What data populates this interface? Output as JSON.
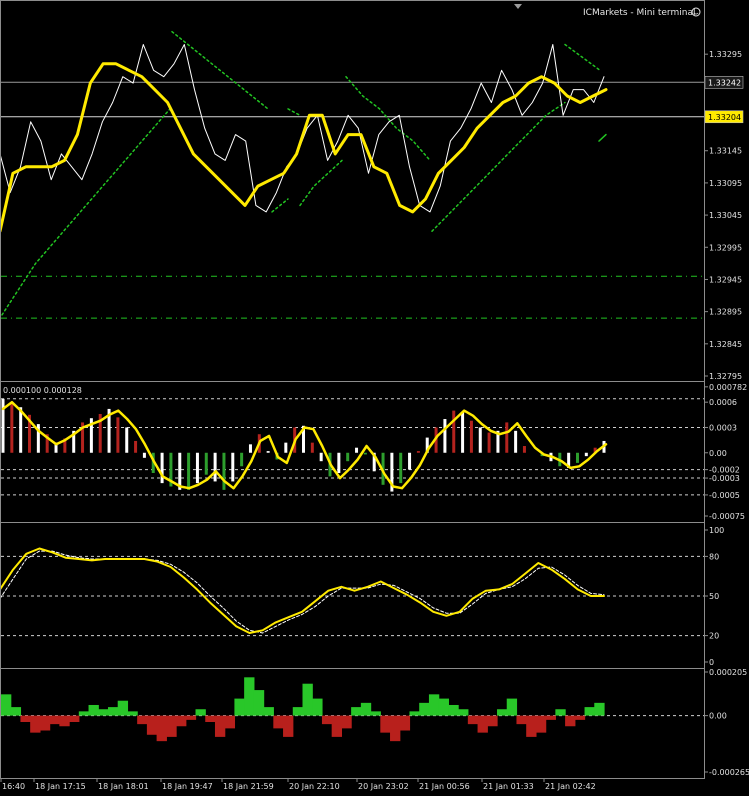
{
  "window": {
    "title": "ICMarkets - Mini terminal",
    "icon": "smiley-icon"
  },
  "colors": {
    "background": "#000000",
    "axis": "#8c8c8c",
    "text": "#e0e0e0",
    "price": "#ffffff",
    "ma": "#ffea00",
    "envelope": "#22c322",
    "osc_hist": "#ffffff",
    "osc_hist_up": "#b4231e",
    "hist_down": "#2d9e2d",
    "stoch": "#ffea00",
    "bars_up": "#29c729",
    "bars_down": "#b8201c",
    "price_tag_bg": "#ffea00",
    "price_tag_fg": "#000000"
  },
  "chart_data": [
    {
      "type": "line",
      "panel": "main",
      "ylim": [
        1.32795,
        1.33345
      ],
      "y_ticks": [
        "1.33295",
        "1.33145",
        "1.33095",
        "1.33045",
        "1.32995",
        "1.32945",
        "1.32895",
        "1.32845",
        "1.32795"
      ],
      "price_tags": [
        "1.33242",
        "1.33204"
      ],
      "dashed_levels": [
        1.3295,
        1.32885
      ],
      "series": [
        {
          "role": "price",
          "values": [
            1.3314,
            1.3308,
            1.3312,
            1.3319,
            1.3316,
            1.331,
            1.3314,
            1.3312,
            1.331,
            1.3314,
            1.3319,
            1.3322,
            1.3326,
            1.3325,
            1.3331,
            1.3327,
            1.3326,
            1.3328,
            1.3331,
            1.3324,
            1.3318,
            1.3314,
            1.3313,
            1.3317,
            1.3316,
            1.3306,
            1.3305,
            1.3308,
            1.3312,
            1.3314,
            1.3318,
            1.332,
            1.3313,
            1.3316,
            1.332,
            1.3318,
            1.3311,
            1.3317,
            1.3319,
            1.332,
            1.3312,
            1.3306,
            1.3305,
            1.3309,
            1.3316,
            1.3318,
            1.3321,
            1.3325,
            1.3322,
            1.3327,
            1.3324,
            1.332,
            1.3322,
            1.3325,
            1.3331,
            1.332,
            1.3324,
            1.3324,
            1.3322,
            1.3326
          ]
        },
        {
          "role": "moving-average",
          "values": [
            1.3302,
            1.3311,
            1.3312,
            1.3312,
            1.3312,
            1.3313,
            1.3317,
            1.3325,
            1.3328,
            1.3328,
            1.3327,
            1.3326,
            1.3324,
            1.3322,
            1.3318,
            1.3314,
            1.3312,
            1.331,
            1.3308,
            1.3306,
            1.3309,
            1.331,
            1.3311,
            1.3314,
            1.332,
            1.332,
            1.3314,
            1.3317,
            1.3317,
            1.3312,
            1.3311,
            1.3306,
            1.3305,
            1.3307,
            1.3311,
            1.3313,
            1.3315,
            1.3318,
            1.332,
            1.3322,
            1.3323,
            1.3325,
            1.3326,
            1.3325,
            1.3323,
            1.3322,
            1.3323,
            1.3324
          ]
        },
        {
          "role": "envelope-lower-left",
          "values": [
            1.3289,
            1.3293,
            1.3297,
            1.33,
            1.3303,
            1.3306,
            1.3309,
            1.3312,
            1.3315,
            1.3318,
            1.3321
          ]
        },
        {
          "role": "envelope-upper",
          "values": [
            1.3333,
            1.333,
            1.3327,
            1.3324,
            1.3321
          ]
        },
        {
          "role": "envelope-segment-a",
          "values": [
            1.3305,
            1.3307
          ]
        },
        {
          "role": "envelope-segment-b",
          "values": [
            1.3321,
            1.332
          ]
        },
        {
          "role": "envelope-segment-c",
          "values": [
            1.3306,
            1.3309,
            1.3311,
            1.3313
          ]
        },
        {
          "role": "envelope-segment-d",
          "values": [
            1.3326,
            1.3323,
            1.3321,
            1.3318,
            1.3316,
            1.3313
          ]
        },
        {
          "role": "envelope-lower-right",
          "values": [
            1.3302,
            1.3305,
            1.3308,
            1.3311,
            1.3314,
            1.3317,
            1.332,
            1.3322
          ]
        },
        {
          "role": "envelope-upper-right",
          "values": [
            1.3331,
            1.3329,
            1.3327
          ]
        },
        {
          "role": "envelope-tail",
          "values": [
            1.3316,
            1.3317
          ]
        }
      ]
    },
    {
      "type": "bar",
      "panel": "oscillator",
      "header": "0.000100 0.000128",
      "ylim": [
        -0.00075,
        0.00078
      ],
      "y_ticks": [
        "0.000782",
        "0.0006",
        "0.0003",
        "0.00",
        "-0.0002",
        "-0.0003",
        "-0.0005",
        "-0.00075"
      ],
      "dashed_levels": [
        0.00064,
        0.0003,
        -0.0002,
        -0.0003,
        -0.0005
      ],
      "signal": [
        0.00052,
        0.0006,
        0.0005,
        0.00038,
        0.00026,
        0.00018,
        0.0001,
        0.00015,
        0.00022,
        0.0003,
        0.00034,
        0.00038,
        0.00045,
        0.0005,
        0.0004,
        0.00028,
        0.0001,
        -0.0001,
        -0.00028,
        -0.00034,
        -0.0004,
        -0.00042,
        -0.00038,
        -0.00032,
        -0.00022,
        -0.00034,
        -0.00042,
        -0.00028,
        -0.0001,
        0.00014,
        0.0002,
        -5e-05,
        -0.00012,
        0.00016,
        0.0003,
        0.00028,
        8e-05,
        -0.00015,
        -0.0003,
        -0.0002,
        -8e-05,
        8e-05,
        -5e-05,
        -0.00025,
        -0.0004,
        -0.00042,
        -0.0003,
        -0.00015,
        5e-05,
        0.0002,
        0.0003,
        0.0004,
        0.0005,
        0.00044,
        0.00034,
        0.00026,
        0.00022,
        0.00025,
        0.00035,
        0.0002,
        6e-05,
        -2e-05,
        -5e-05,
        -0.0001,
        -0.00018,
        -0.00016,
        -8e-05,
        2e-05,
        0.0001
      ],
      "values": [
        0.00064,
        0.0006,
        0.00054,
        0.00045,
        0.00034,
        0.00022,
        0.00012,
        0.00017,
        0.00026,
        0.00036,
        0.00041,
        0.00046,
        0.00052,
        0.00042,
        0.0003,
        0.00014,
        -6e-05,
        -0.00024,
        -0.00036,
        -0.0004,
        -0.00044,
        -0.00044,
        -0.00036,
        -0.00026,
        -0.00034,
        -0.00044,
        -0.00034,
        -0.00016,
        0.0001,
        0.00022,
        2e-05,
        -8e-05,
        0.00012,
        0.0003,
        0.00032,
        0.00012,
        -0.0001,
        -0.00028,
        -0.00024,
        -0.0001,
        6e-05,
        -2e-05,
        -0.00022,
        -0.00038,
        -0.00046,
        -0.00036,
        -0.0002,
        2e-05,
        0.00018,
        0.0003,
        0.0004,
        0.0005,
        0.00048,
        0.00038,
        0.0003,
        0.00024,
        0.00026,
        0.00036,
        0.00026,
        8e-05,
        0.0,
        -4e-05,
        -0.0001,
        -0.00016,
        -0.00018,
        -0.00012,
        -4e-05,
        6e-05,
        0.00014
      ]
    },
    {
      "type": "line",
      "panel": "stochastic",
      "ylim": [
        0,
        100
      ],
      "y_ticks": [
        "100",
        "80",
        "50",
        "20",
        "0"
      ],
      "dashed_levels": [
        80,
        50,
        20
      ],
      "series": [
        {
          "role": "main",
          "values": [
            55,
            70,
            82,
            86,
            83,
            79,
            78,
            77,
            78,
            78,
            78,
            78,
            76,
            72,
            64,
            55,
            45,
            36,
            27,
            22,
            24,
            30,
            34,
            38,
            46,
            54,
            57,
            54,
            57,
            61,
            56,
            51,
            45,
            38,
            35,
            38,
            48,
            54,
            55,
            59,
            67,
            75,
            70,
            63,
            55,
            50,
            50
          ]
        },
        {
          "role": "signal",
          "values": [
            48,
            63,
            78,
            84,
            84,
            81,
            79,
            78,
            78,
            78,
            78,
            78,
            77,
            74,
            68,
            60,
            50,
            41,
            31,
            24,
            22,
            27,
            32,
            36,
            42,
            50,
            56,
            56,
            56,
            59,
            58,
            53,
            48,
            41,
            37,
            37,
            44,
            52,
            55,
            57,
            63,
            71,
            72,
            66,
            58,
            52,
            51
          ]
        }
      ]
    },
    {
      "type": "bar",
      "panel": "histogram",
      "ylim": [
        -0.000265,
        0.000205
      ],
      "y_ticks": [
        "0.000205",
        "0.00",
        "-0.000265"
      ],
      "values": [
        0.0001,
        4e-05,
        -3e-05,
        -8e-05,
        -7e-05,
        -4e-05,
        -5e-05,
        -3e-05,
        2e-05,
        5e-05,
        3e-05,
        4e-05,
        7e-05,
        2e-05,
        -4e-05,
        -9e-05,
        -0.00012,
        -0.0001,
        -5e-05,
        -2e-05,
        3e-05,
        -3e-05,
        -0.0001,
        -6e-05,
        8e-05,
        0.00018,
        0.00012,
        4e-05,
        -6e-05,
        -0.0001,
        4e-05,
        0.00015,
        8e-05,
        -4e-05,
        -0.0001,
        -6e-05,
        4e-05,
        6e-05,
        2e-05,
        -8e-05,
        -0.00012,
        -7e-05,
        2e-05,
        6e-05,
        0.0001,
        8e-05,
        5e-05,
        3e-05,
        -4e-05,
        -8e-05,
        -5e-05,
        3e-05,
        8e-05,
        -4e-05,
        -0.0001,
        -8e-05,
        -2e-05,
        3e-05,
        -5e-05,
        -2e-05,
        4e-05,
        6e-05
      ]
    }
  ],
  "time_axis": [
    "16:40",
    "18 Jan 17:15",
    "18 Jan 18:01",
    "18 Jan 19:47",
    "18 Jan 21:59",
    "20 Jan 22:10",
    "20 Jan 23:02",
    "21 Jan 00:56",
    "21 Jan 01:33",
    "21 Jan 02:42"
  ],
  "stoch_dashed_labels": []
}
